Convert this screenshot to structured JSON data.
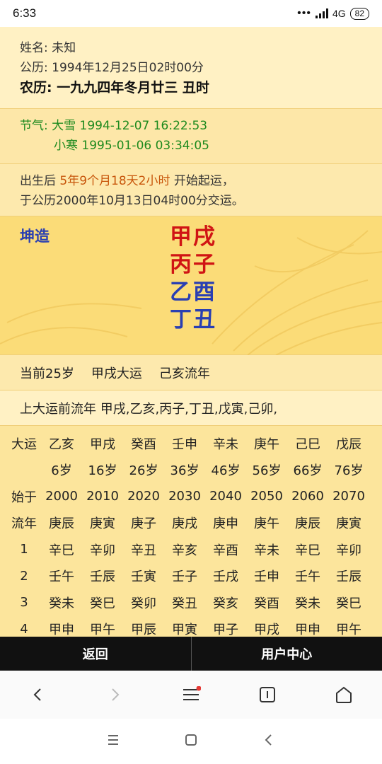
{
  "status_bar": {
    "time": "6:33",
    "network": "4G",
    "battery": "82"
  },
  "info": {
    "name": "姓名: 未知",
    "gongli": "公历: 1994年12月25日02时00分",
    "nongli": "农历: 一九九四年冬月廿三 丑时"
  },
  "jieqi": {
    "label": "节气:",
    "term1": "大雪 1994-12-07 16:22:53",
    "term2": "小寒 1995-01-06 03:34:05"
  },
  "qiyun": {
    "prefix": "出生后 ",
    "duration": "5年9个月18天2小时",
    "suffix": " 开始起运，",
    "line2": "于公历2000年10月13日04时00分交运。"
  },
  "bazi": {
    "label": "坤造",
    "pillars": [
      {
        "text": "甲戌",
        "color": "#d01414"
      },
      {
        "text": "丙子",
        "color": "#d01414"
      },
      {
        "text": "乙酉",
        "color": "#2a3fb2"
      },
      {
        "text": "丁丑",
        "color": "#2a3fb2"
      }
    ]
  },
  "current": {
    "age": "当前25岁",
    "dayun": "甲戌大运",
    "liunian": "己亥流年"
  },
  "pre_dayun": "上大运前流年 甲戌,乙亥,丙子,丁丑,戊寅,己卯,",
  "table": {
    "active_col": 1,
    "rows": [
      [
        "大运",
        "乙亥",
        "甲戌",
        "癸酉",
        "壬申",
        "辛未",
        "庚午",
        "己巳",
        "戊辰"
      ],
      [
        "",
        "6岁",
        "16岁",
        "26岁",
        "36岁",
        "46岁",
        "56岁",
        "66岁",
        "76岁"
      ],
      [
        "始于",
        "2000",
        "2010",
        "2020",
        "2030",
        "2040",
        "2050",
        "2060",
        "2070"
      ],
      [
        "流年",
        "庚辰",
        "庚寅",
        "庚子",
        "庚戌",
        "庚申",
        "庚午",
        "庚辰",
        "庚寅"
      ],
      [
        "1",
        "辛巳",
        "辛卯",
        "辛丑",
        "辛亥",
        "辛酉",
        "辛未",
        "辛巳",
        "辛卯"
      ],
      [
        "2",
        "壬午",
        "壬辰",
        "壬寅",
        "壬子",
        "壬戌",
        "壬申",
        "壬午",
        "壬辰"
      ],
      [
        "3",
        "癸未",
        "癸巳",
        "癸卯",
        "癸丑",
        "癸亥",
        "癸酉",
        "癸未",
        "癸巳"
      ],
      [
        "4",
        "甲申",
        "甲午",
        "甲辰",
        "甲寅",
        "甲子",
        "甲戌",
        "甲申",
        "甲午"
      ]
    ]
  },
  "bottom_tabs": {
    "back": "返回",
    "user_center": "用户中心"
  },
  "colors": {
    "red": "#d01414",
    "blue": "#2a3fb2",
    "green": "#1e8a1e",
    "orange": "#c8560b"
  }
}
